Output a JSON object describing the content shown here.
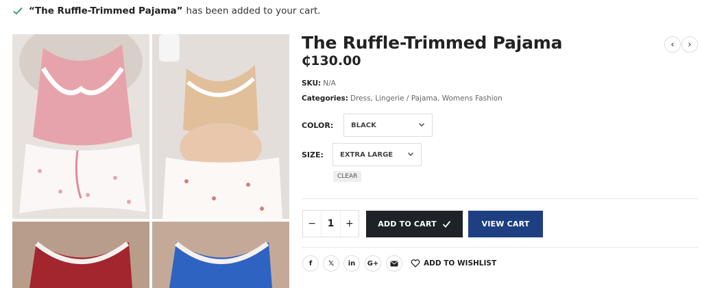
{
  "notice": {
    "product": "“The Ruffle-Trimmed Pajama”",
    "message": "has been added to your cart."
  },
  "product": {
    "title": "The Ruffle-Trimmed Pajama",
    "price": "₵130.00",
    "sku_label": "SKU:",
    "sku_value": "N/A",
    "categories_label": "Categories:",
    "categories": [
      "Dress",
      "Lingerie / Pajama",
      "Womens Fashion"
    ]
  },
  "variations": {
    "color_label": "COLOR:",
    "color_value": "BLACK",
    "size_label": "SIZE:",
    "size_value": "EXTRA LARGE",
    "clear_label": "CLEAR"
  },
  "cart": {
    "minus": "−",
    "quantity": "1",
    "plus": "+",
    "add_to_cart_label": "ADD TO CART",
    "view_cart_label": "VIEW CART"
  },
  "share": {
    "facebook": "f",
    "x": "𝕏",
    "linkedin": "in",
    "google": "G+",
    "wishlist_label": "ADD TO WISHLIST"
  },
  "nav": {
    "prev": "‹",
    "next": "›"
  },
  "colors": {
    "accent_dark": "#1f2328",
    "accent_blue": "#1e3f82",
    "success": "#2ea36b"
  },
  "gallery": [
    "pink-top-floral-shorts",
    "tan-top-floral-shorts",
    "red-lace-top",
    "blue-lace-top"
  ]
}
